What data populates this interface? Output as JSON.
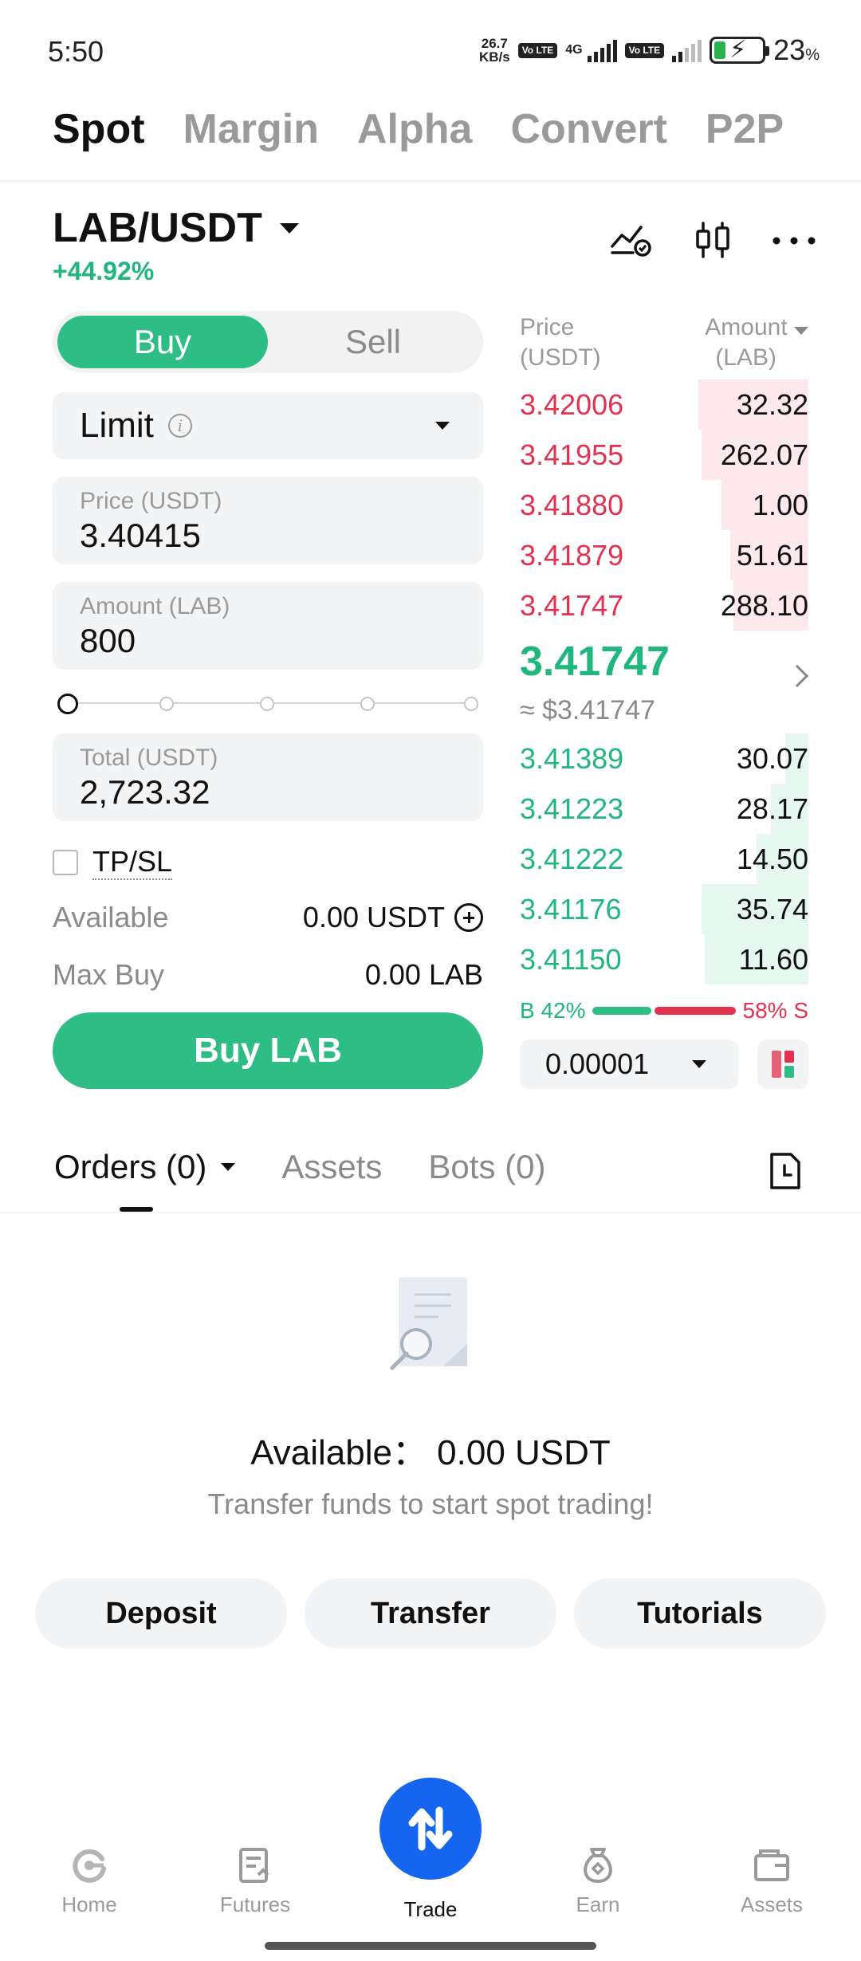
{
  "status_bar": {
    "time": "5:50",
    "speed_value": "26.7",
    "speed_unit": "KB/s",
    "volte_1": "Vo LTE",
    "network": "4G",
    "volte_2": "Vo LTE",
    "battery_percent": "23",
    "battery_suffix": "%"
  },
  "top_tabs": [
    "Spot",
    "Margin",
    "Alpha",
    "Convert",
    "P2P"
  ],
  "pair": {
    "name": "LAB/USDT",
    "change": "+44.92%"
  },
  "order_form": {
    "buy_label": "Buy",
    "sell_label": "Sell",
    "order_type": "Limit",
    "price_label": "Price (USDT)",
    "price_value": "3.40415",
    "amount_label": "Amount (LAB)",
    "amount_value": "800",
    "total_label": "Total (USDT)",
    "total_value": "2,723.32",
    "tpsl_label": "TP/SL",
    "available_label": "Available",
    "available_value": "0.00 USDT",
    "max_buy_label": "Max Buy",
    "max_buy_value": "0.00 LAB",
    "submit_label": "Buy LAB"
  },
  "order_book": {
    "price_header": "Price",
    "price_unit": "(USDT)",
    "amount_header": "Amount",
    "amount_unit": "(LAB)",
    "asks": [
      {
        "price": "3.42006",
        "amount": "32.32",
        "depth": 0.38
      },
      {
        "price": "3.41955",
        "amount": "262.07",
        "depth": 0.37
      },
      {
        "price": "3.41880",
        "amount": "1.00",
        "depth": 0.3
      },
      {
        "price": "3.41879",
        "amount": "51.61",
        "depth": 0.27
      },
      {
        "price": "3.41747",
        "amount": "288.10",
        "depth": 0.26
      }
    ],
    "last_price": "3.41747",
    "last_price_usd": "≈ $3.41747",
    "bids": [
      {
        "price": "3.41389",
        "amount": "30.07",
        "depth": 0.08
      },
      {
        "price": "3.41223",
        "amount": "28.17",
        "depth": 0.13
      },
      {
        "price": "3.41222",
        "amount": "14.50",
        "depth": 0.18
      },
      {
        "price": "3.41176",
        "amount": "35.74",
        "depth": 0.37
      },
      {
        "price": "3.41150",
        "amount": "11.60",
        "depth": 0.36
      }
    ],
    "buy_ratio_label": "B 42%",
    "sell_ratio_label": "58% S",
    "buy_ratio": 0.42,
    "tick_size": "0.00001"
  },
  "orders_section": {
    "tabs": {
      "orders": "Orders (0)",
      "assets": "Assets",
      "bots": "Bots (0)"
    },
    "available_text": "Available：  0.00 USDT",
    "hint": "Transfer funds to start spot trading!",
    "actions": [
      "Deposit",
      "Transfer",
      "Tutorials"
    ]
  },
  "bottom_nav": {
    "home": "Home",
    "futures": "Futures",
    "trade": "Trade",
    "earn": "Earn",
    "assets": "Assets"
  },
  "colors": {
    "green": "#2dbd85",
    "red": "#e2324f",
    "trade_blue": "#1565f0"
  }
}
